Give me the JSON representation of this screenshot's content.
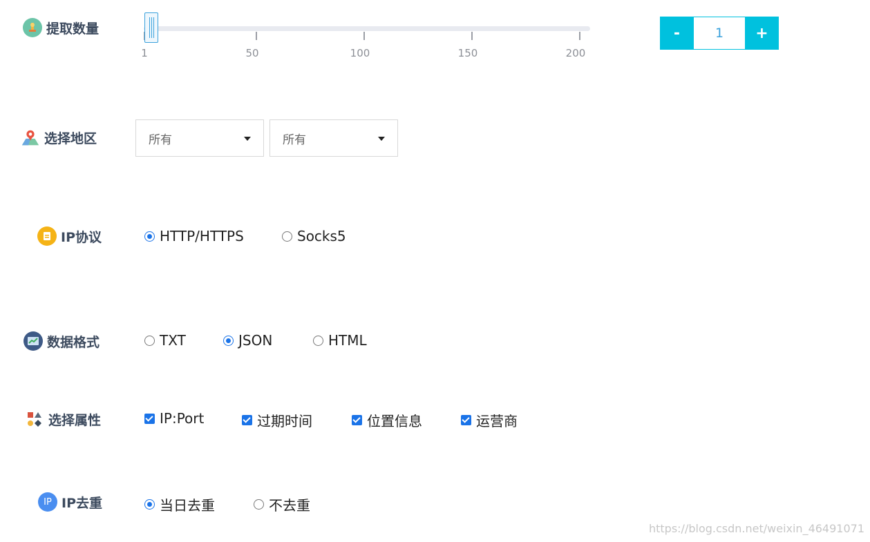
{
  "quantity": {
    "label": "提取数量",
    "slider": {
      "min": 1,
      "max": 200,
      "value": 1,
      "ticks": [
        "1",
        "50",
        "100",
        "150",
        "200"
      ]
    },
    "stepper": {
      "minus": "-",
      "value": "1",
      "plus": "+"
    }
  },
  "region": {
    "label": "选择地区",
    "select1": "所有",
    "select2": "所有"
  },
  "protocol": {
    "label": "IP协议",
    "options": [
      "HTTP/HTTPS",
      "Socks5"
    ],
    "selected": "HTTP/HTTPS"
  },
  "format": {
    "label": "数据格式",
    "options": [
      "TXT",
      "JSON",
      "HTML"
    ],
    "selected": "JSON"
  },
  "attributes": {
    "label": "选择属性",
    "options": [
      "IP:Port",
      "过期时间",
      "位置信息",
      "运营商"
    ],
    "checked": [
      true,
      true,
      true,
      true
    ]
  },
  "dedupe": {
    "label": "IP去重",
    "options": [
      "当日去重",
      "不去重"
    ],
    "selected": "当日去重"
  },
  "watermark": "https://blog.csdn.net/weixin_46491071",
  "colors": {
    "accent": "#00c1de",
    "control": "#1a73e8",
    "label": "#3c4a5e"
  }
}
